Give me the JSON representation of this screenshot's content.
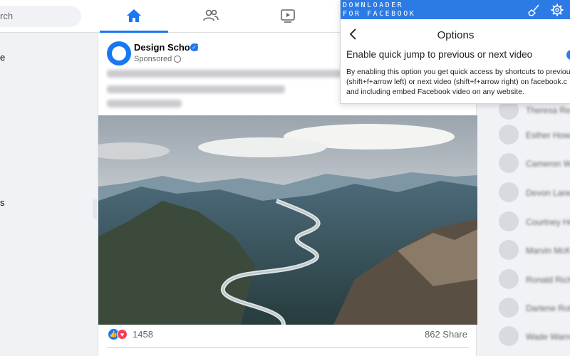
{
  "search": {
    "placeholder": "rch"
  },
  "nav": {
    "home_icon": "home-icon",
    "friends_icon": "friends-icon",
    "watch_icon": "watch-icon",
    "accent": "#1877f2"
  },
  "left_nav": {
    "frag_1": "e",
    "frag_2": "s"
  },
  "post": {
    "author": "Design School",
    "sponsored": "Sponsored",
    "verified_icon": "verified-badge-icon",
    "reaction_count": "1458",
    "share_count": "862 Share"
  },
  "popup": {
    "brand_line_1": "DOWNLOADER",
    "brand_line_2": "FOR FACEBOOK",
    "title": "Options",
    "setting_label": "Enable quick jump to previous or next video",
    "setting_enabled": true,
    "description": "By enabling this option you get quick access by shortcuts to previous (shift+f+arrow left) or next video (shift+f+arrow right) on facebook.c and including embed Facebook video on any website.",
    "head_color": "#2c7be5"
  },
  "contacts": [
    {
      "name": "Theresa Res"
    },
    {
      "name": "Esther Howa"
    },
    {
      "name": "Cameron Wil"
    },
    {
      "name": "Devon Lane"
    },
    {
      "name": "Courtney He"
    },
    {
      "name": "Marvin McK"
    },
    {
      "name": "Ronald Rich"
    },
    {
      "name": "Darlene Rob"
    },
    {
      "name": "Wade Warre"
    }
  ]
}
